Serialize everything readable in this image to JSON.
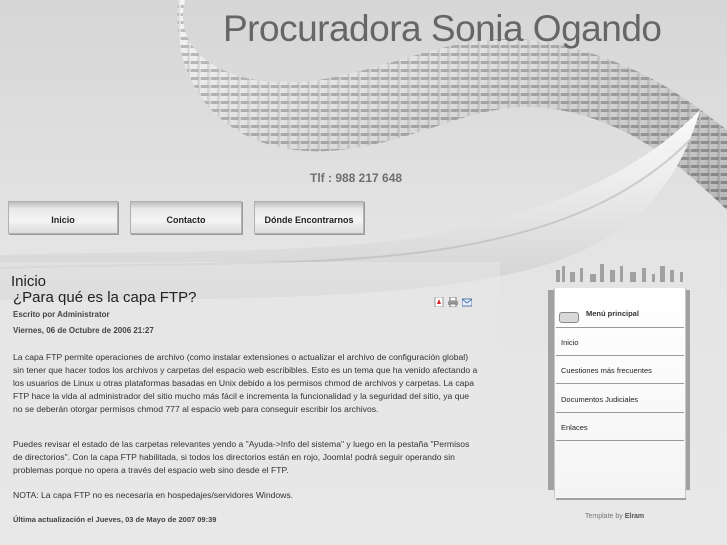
{
  "header": {
    "site_title": "Procuradora Sonia Ogando",
    "phone": "Tlf : 988 217 648"
  },
  "nav": {
    "items": [
      {
        "label": "Inicio"
      },
      {
        "label": "Contacto"
      },
      {
        "label": "Dónde Encontrarnos"
      }
    ]
  },
  "main": {
    "page_heading": "Inicio",
    "article_title": "¿Para qué es la capa FTP?",
    "author": "Escrito por Administrator",
    "date": "Viernes, 06 de Octubre de 2006 21:27",
    "icons": [
      "pdf-icon",
      "print-icon",
      "email-icon"
    ],
    "paragraphs": [
      "La capa FTP permite operaciones de archivo (como instalar extensiones o actualizar el archivo de configuración global) sin tener que hacer todos los archivos y carpetas del espacio web escribibles. Esto es un tema que ha venido afectando a los usuarios de Linux u otras plataformas basadas en Unix debido a los permisos chmod de archivos y carpetas. La capa FTP hace la vida al administrador del sitio mucho más fácil e incrementa la funcionalidad y la seguridad del sitio, ya que no se deberán otorgar permisos chmod 777 al espacio web para conseguir escribir los archivos.",
      "Puedes revisar el estado de las carpetas relevantes yendo a \"Ayuda->Info del sistema\" y luego en la pestaña \"Permisos de directorios\". Con la capa FTP habilitada, si todos los directorios están en rojo, Joomla! podrá seguir operando sin problemas porque no opera a través del espacio web sino desde el FTP.",
      "NOTA: La capa FTP no es necesaria en hospedajes/servidores Windows."
    ],
    "last_updated": "Última actualización el Jueves, 03 de Mayo de 2007 09:39"
  },
  "sidebar": {
    "menu_title": "Menú principal",
    "items": [
      {
        "label": "Inicio"
      },
      {
        "label": "Cuestiones más frecuentes"
      },
      {
        "label": "Documentos Judiciales"
      },
      {
        "label": "Enlaces"
      }
    ]
  },
  "footer": {
    "credit_prefix": "Template by",
    "credit_name": "Elram"
  }
}
